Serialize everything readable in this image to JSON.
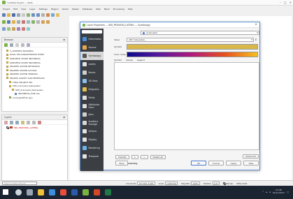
{
  "app": {
    "title": "*untitled Project — QGIS",
    "menu": [
      "Project",
      "Edit",
      "View",
      "Layer",
      "Settings",
      "Plugins",
      "Vector",
      "Raster",
      "Database",
      "Web",
      "Mesh",
      "Processing",
      "Help"
    ]
  },
  "browser": {
    "title": "Browser",
    "items": [
      "1_LEGENDA NASIONAL",
      "HASIL TES KARAKTERISTIK RTRW",
      "KONVERSI SHAPE INDONESIA",
      "KONVERSI SHAPE INDONESIA",
      "PRAKTEK SISTEM INFORMASI",
      "PRAKTEK SISTEM SATUAN",
      "PRAKTEK SISTEM TERPADU",
      "PRAKTIK SURVEY DAN PEMETAAN",
      "FINAL PROJECT PPL",
      "SHP_Indonesia_Kabupaten",
      "SHP_Indonesia_Kabupaten",
      "INDONESIA_KAB.shp",
      "ancangshifiran.gpx"
    ]
  },
  "layers": {
    "title": "Layers",
    "layer_name": "IND_PROVINSI_LATENG"
  },
  "dialog": {
    "title": "Layer Properties — IND_PROVINSI_LATENG — Symbology",
    "renderer": "Graduated",
    "value_label": "Value",
    "value": "ABC Kabupaten_",
    "symbol_label": "Symbol",
    "ramp_label": "Color ramp",
    "columns": [
      "Symbol",
      "Values",
      "Legend"
    ],
    "sidebar": [
      "Information",
      "Source",
      "Symbology",
      "Labels",
      "Masks",
      "3D View",
      "Diagrams",
      "Fields",
      "Attributes Form",
      "Joins",
      "Auxiliary Storage",
      "Actions",
      "Display",
      "Rendering",
      "Temporal"
    ],
    "classify_btn": "Classify",
    "delete_all_btn": "Delete All",
    "advanced_btn": "Advanced",
    "layer_rendering": "Layer Rendering",
    "style_btn": "Style",
    "ok_btn": "OK",
    "cancel_btn": "Cancel",
    "apply_btn": "Apply",
    "help_btn": "Help"
  },
  "status": {
    "locator_placeholder": "Type to locate (Ctrl+K)",
    "coordinate_label": "Coordinate",
    "coordinate": "107.322,-5.997",
    "scale_label": "Scale",
    "scale": "1:249'729",
    "magnifier_label": "Magnifier",
    "magnifier": "100%",
    "rotation_label": "Rotation",
    "rotation": "0.0°",
    "render_label": "Render",
    "epsg": "EPSG:4326"
  },
  "taskbar": {
    "time": "13:48",
    "date": "02/11/2021"
  },
  "colors": {
    "symbol": "#d9b84a",
    "sidebar": "#3b3f44",
    "accent": "#4a7bd0"
  }
}
